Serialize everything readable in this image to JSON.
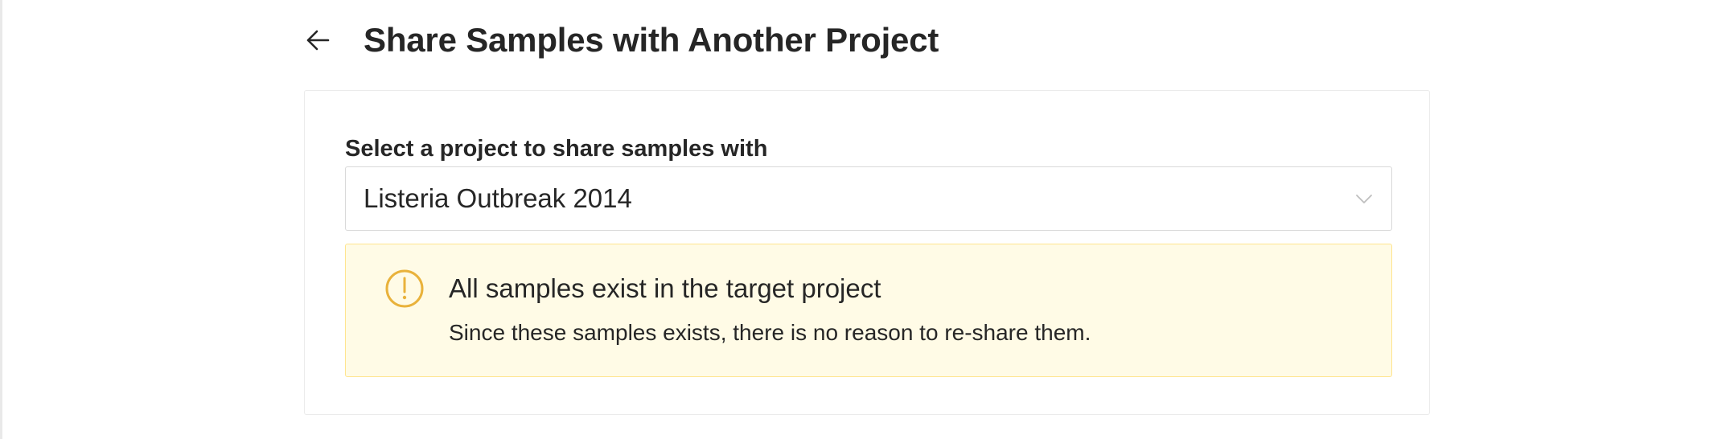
{
  "header": {
    "back_icon": "arrow-left-icon",
    "title": "Share Samples with Another Project"
  },
  "form": {
    "project_label": "Select a project to share samples with",
    "project_select": {
      "value": "Listeria Outbreak 2014",
      "icon": "chevron-down-icon"
    }
  },
  "alert": {
    "type": "warning",
    "icon": "exclamation-circle-icon",
    "title": "All samples exist in the target project",
    "description": "Since these samples exists, there is no reason to re-share them."
  },
  "colors": {
    "warning_icon": "#e9b23b",
    "warning_background": "#fffbe6",
    "warning_border": "#ffe58f",
    "text": "#262626"
  }
}
